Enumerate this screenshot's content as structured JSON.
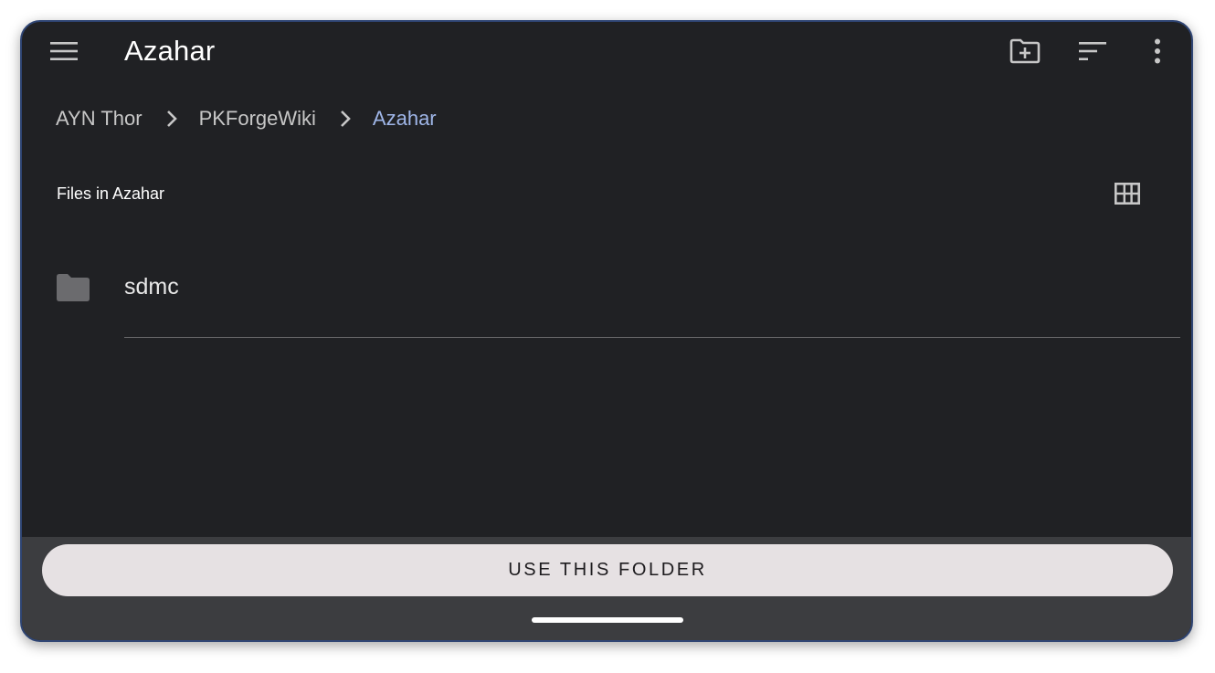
{
  "app_bar": {
    "title": "Azahar",
    "menu_icon": "hamburger-menu-icon",
    "actions": [
      {
        "icon": "create-folder-icon"
      },
      {
        "icon": "sort-icon"
      },
      {
        "icon": "more-vert-icon"
      }
    ]
  },
  "breadcrumb": {
    "items": [
      "AYN Thor",
      "PKForgeWiki",
      "Azahar"
    ],
    "separator_icon": "chevron-right-icon"
  },
  "section": {
    "header": "Files in Azahar",
    "view_toggle_icon": "grid-view-icon"
  },
  "files": [
    {
      "name": "sdmc",
      "icon": "folder-icon"
    }
  ],
  "bottom": {
    "use_folder_label": "USE THIS FOLDER"
  },
  "colors": {
    "background": "#202124",
    "bottom_bar": "#3c3d40",
    "button_bg": "#e6e1e3",
    "active_crumb": "#9fb6e8",
    "icon": "#c7c7c7",
    "folder": "#6b6b6e"
  }
}
